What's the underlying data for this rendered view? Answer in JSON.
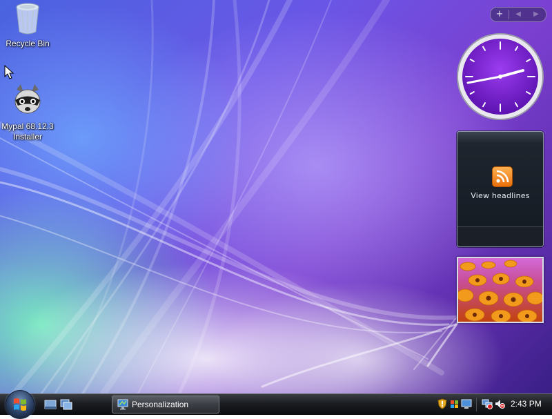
{
  "desktop": {
    "icons": [
      {
        "label": "Recycle Bin"
      },
      {
        "label": "Mypal 68.12.3 Installer"
      }
    ]
  },
  "sidebar": {
    "controls": {
      "add": "+",
      "previous": "◀",
      "next": "▶"
    }
  },
  "gadgets": {
    "clock": {
      "time": "2:43",
      "face_color": "#7a1fd6"
    },
    "feed": {
      "label": "View headlines",
      "icon": "rss-icon"
    },
    "slideshow": {
      "subject": "orange flowers"
    }
  },
  "taskbar": {
    "start": {
      "icon": "windows-logo-icon"
    },
    "quick_launch": [
      {
        "icon": "show-desktop-icon"
      },
      {
        "icon": "switch-windows-icon"
      }
    ],
    "tasks": [
      {
        "label": "Personalization",
        "icon": "display-settings-icon"
      }
    ],
    "tray": {
      "icons": [
        "security-shield-icon",
        "windows-update-icon",
        "display-icon",
        "network-icon",
        "volume-muted-icon"
      ],
      "clock": "2:43 PM"
    }
  },
  "colors": {
    "accent": "#7a1fd6",
    "taskbar": "#1b1d21",
    "rss": "#f28a1e"
  }
}
